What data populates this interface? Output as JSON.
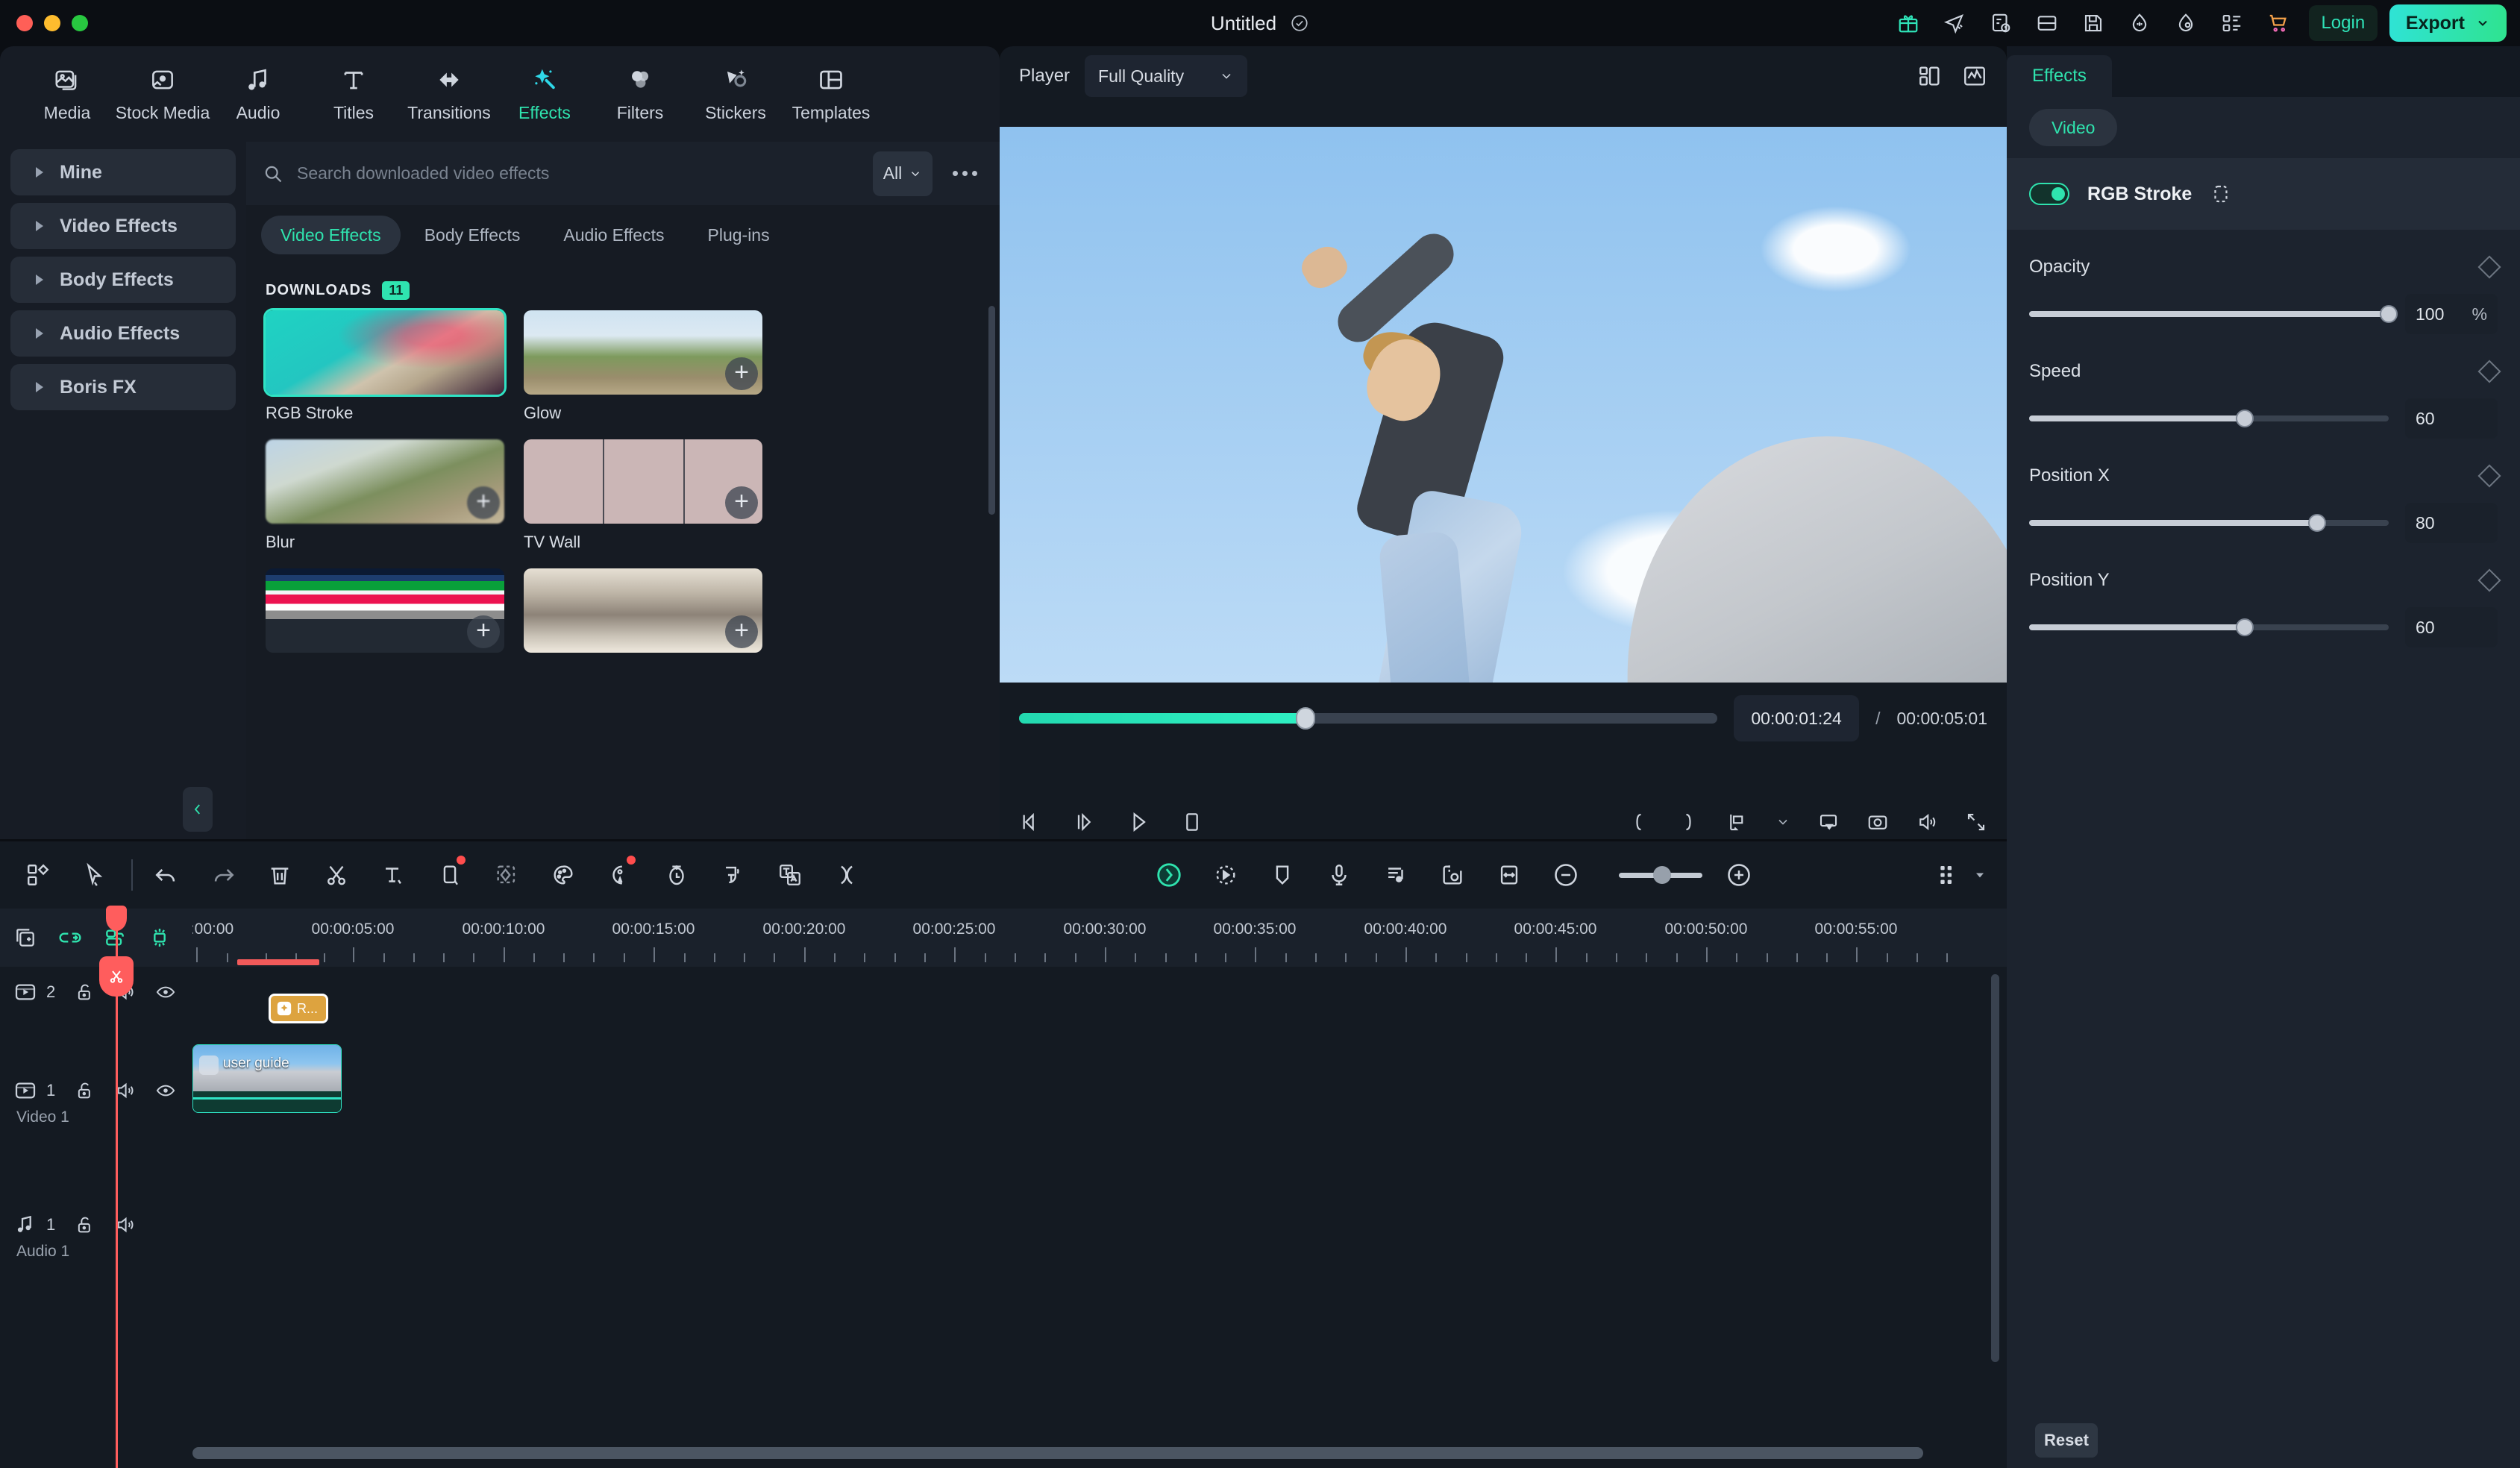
{
  "titlebar": {
    "project_title": "Untitled",
    "check_icon": "check-circle-icon",
    "icons": [
      "gift-icon",
      "send-icon",
      "feedback-icon",
      "layout-icon",
      "save-icon",
      "download-icon",
      "headset-icon",
      "apps-icon",
      "cart-icon"
    ],
    "login_label": "Login",
    "export_label": "Export"
  },
  "topnav": {
    "items": [
      {
        "label": "Media",
        "icon": "media-icon"
      },
      {
        "label": "Stock Media",
        "icon": "stock-media-icon"
      },
      {
        "label": "Audio",
        "icon": "audio-note-icon"
      },
      {
        "label": "Titles",
        "icon": "titles-t-icon"
      },
      {
        "label": "Transitions",
        "icon": "transitions-arrows-icon"
      },
      {
        "label": "Effects",
        "icon": "effects-wand-icon"
      },
      {
        "label": "Filters",
        "icon": "filters-circles-icon"
      },
      {
        "label": "Stickers",
        "icon": "stickers-icon"
      },
      {
        "label": "Templates",
        "icon": "templates-icon"
      }
    ],
    "active_index": 5
  },
  "sidebar": {
    "categories": [
      {
        "label": "Mine"
      },
      {
        "label": "Video Effects"
      },
      {
        "label": "Body Effects"
      },
      {
        "label": "Audio Effects"
      },
      {
        "label": "Boris FX"
      }
    ],
    "collapse_icon": "chevron-left-icon"
  },
  "browser": {
    "search_placeholder": "Search downloaded video effects",
    "search_icon": "search-icon",
    "filter_label": "All",
    "more_icon": "more-horizontal-icon",
    "tabs": [
      {
        "label": "Video Effects"
      },
      {
        "label": "Body Effects"
      },
      {
        "label": "Audio Effects"
      },
      {
        "label": "Plug-ins"
      }
    ],
    "active_tab": 0,
    "section_title": "DOWNLOADS",
    "section_count": "11",
    "items": [
      {
        "name": "RGB Stroke",
        "selected": true,
        "thumb": "th-rgb"
      },
      {
        "name": "Glow",
        "selected": false,
        "thumb": "th-glow"
      },
      {
        "name": "Blur",
        "selected": false,
        "thumb": "th-blur"
      },
      {
        "name": "TV Wall",
        "selected": false,
        "thumb": "th-tv"
      },
      {
        "name": "",
        "selected": false,
        "thumb": "th-glitch"
      },
      {
        "name": "",
        "selected": false,
        "thumb": "th-sketch"
      }
    ]
  },
  "player": {
    "label": "Player",
    "quality": "Full Quality",
    "quality_caret": "chevron-down-icon",
    "grid_icon": "layout-grid-icon",
    "scope_icon": "waveform-scope-icon",
    "current_time": "00:00:01:24",
    "separator": "/",
    "total_time": "00:00:05:01",
    "progress_percent": 41,
    "controls": [
      "prev-frame-icon",
      "next-frame-icon",
      "play-icon",
      "stop-icon"
    ],
    "right_controls": [
      "mark-in-icon",
      "mark-out-icon",
      "snapshot-align-icon",
      "chevron-down-icon",
      "screen-icon",
      "camera-icon",
      "volume-icon",
      "fullscreen-icon"
    ]
  },
  "properties": {
    "tab_label": "Effects",
    "chip_label": "Video",
    "effect_name": "RGB Stroke",
    "effect_enabled": true,
    "mask_icon": "mask-rect-icon",
    "keyframe_icon": "keyframe-diamond-icon",
    "params": [
      {
        "label": "Opacity",
        "value": "100",
        "unit": "%",
        "percent": 100
      },
      {
        "label": "Speed",
        "value": "60",
        "unit": "",
        "percent": 60
      },
      {
        "label": "Position X",
        "value": "80",
        "unit": "",
        "percent": 80
      },
      {
        "label": "Position Y",
        "value": "60",
        "unit": "",
        "percent": 60
      }
    ],
    "reset_label": "Reset"
  },
  "toolbar": {
    "left_icons": [
      "grid-view-icon",
      "select-pointer-icon",
      "divider",
      "undo-icon",
      "redo-icon",
      "delete-icon",
      "split-scissors-icon",
      "text-icon",
      "crop-icon",
      "mask-icon",
      "color-palette-icon",
      "ai-audio-icon",
      "speed-icon",
      "auto-caption-icon",
      "translate-icon",
      "detach-audio-icon"
    ],
    "center_icons": [
      "ai-ball-icon",
      "motion-tracking-icon",
      "marker-icon",
      "record-voice-icon",
      "beat-detect-icon",
      "green-screen-icon",
      "fit-timeline-icon"
    ],
    "zoom_out_icon": "zoom-out-icon",
    "zoom_in_icon": "zoom-in-icon",
    "zoom_percent": 52,
    "right_icons": [
      "timeline-options-icon",
      "chevron-down-icon"
    ]
  },
  "timeline": {
    "tools": [
      "add-track-icon",
      "link-clip-icon",
      "group-icon",
      "auto-ripple-icon"
    ],
    "ruler_labels": [
      ":00:00",
      "00:00:05:00",
      "00:00:10:00",
      "00:00:15:00",
      "00:00:20:00",
      "00:00:25:00",
      "00:00:30:00",
      "00:00:35:00",
      "00:00:40:00",
      "00:00:45:00",
      "00:00:50:00",
      "00:00:55:00"
    ],
    "tracks": [
      {
        "kind": "video",
        "number": "2",
        "name": "",
        "icons": [
          "video-track-icon",
          "lock-icon",
          "mute-icon",
          "eye-icon"
        ]
      },
      {
        "kind": "video",
        "number": "1",
        "name": "Video 1",
        "icons": [
          "video-track-icon",
          "lock-icon",
          "mute-icon",
          "eye-icon"
        ]
      },
      {
        "kind": "audio",
        "number": "1",
        "name": "Audio 1",
        "icons": [
          "audio-track-icon",
          "lock-icon",
          "mute-icon"
        ]
      }
    ],
    "effect_clip_label": "R...",
    "video_clip_label": "user guide"
  }
}
